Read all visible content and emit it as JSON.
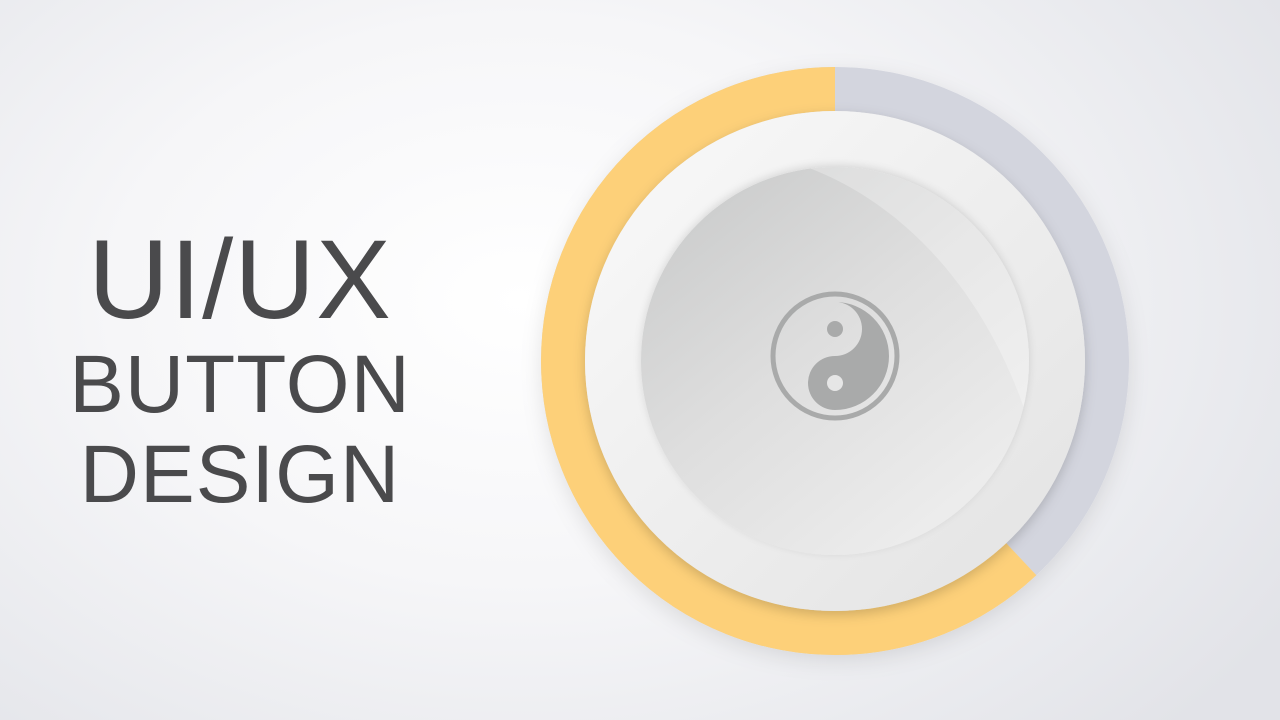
{
  "headline": {
    "line1": "UI/UX",
    "line2": "BUTTON",
    "line3": "DESIGN"
  },
  "knob": {
    "progress_fraction": 0.62,
    "center_icon": "yin-yang-icon",
    "colors": {
      "progress": "#fdd079",
      "track": "#d3d5de",
      "outer_face": "#f4f4f4",
      "inner_face": "#e3e3e3",
      "icon": "#a9aaaa"
    }
  }
}
